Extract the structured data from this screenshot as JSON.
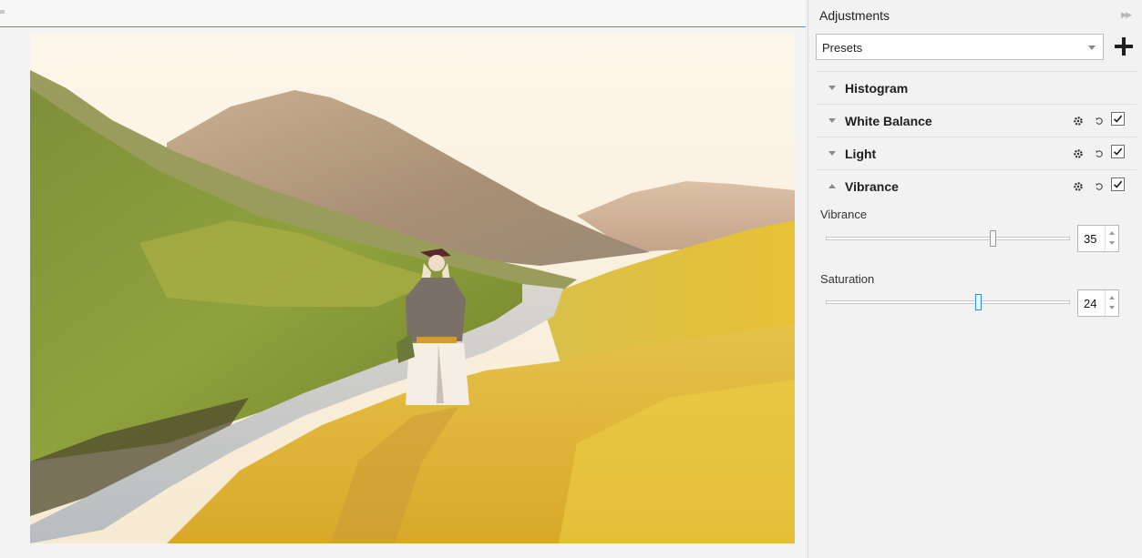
{
  "panel": {
    "title": "Adjustments",
    "presets": {
      "selected": "Presets"
    },
    "sections": [
      {
        "title": "Histogram",
        "expanded": false,
        "controls": false,
        "enabled": null
      },
      {
        "title": "White Balance",
        "expanded": false,
        "controls": true,
        "enabled": true
      },
      {
        "title": "Light",
        "expanded": false,
        "controls": true,
        "enabled": true
      },
      {
        "title": "Vibrance",
        "expanded": true,
        "controls": true,
        "enabled": true
      }
    ],
    "vibrance": {
      "label": "Vibrance",
      "value": "35",
      "slider_fraction": 0.68
    },
    "saturation": {
      "label": "Saturation",
      "value": "24",
      "slider_fraction": 0.62
    }
  },
  "colors": {
    "accent": "#29a3da",
    "panel_bg": "#f2f2f2"
  },
  "icons": {
    "collapse": "double-chevron-right-icon",
    "add": "plus-icon",
    "gear": "gear-icon",
    "reset": "reset-icon",
    "check": "checkbox-checked-icon"
  }
}
